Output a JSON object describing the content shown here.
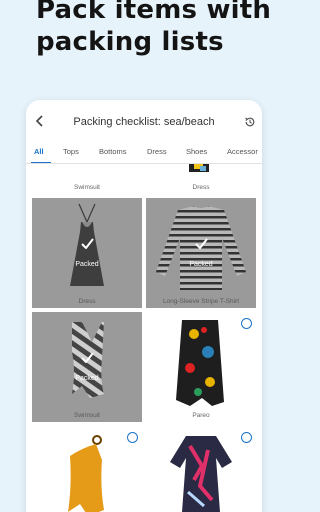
{
  "headline": {
    "line1": "Pack items with",
    "line2": "packing lists"
  },
  "appbar": {
    "title": "Packing checklist: sea/beach"
  },
  "tabs": [
    {
      "label": "All",
      "active": true
    },
    {
      "label": "Tops"
    },
    {
      "label": "Bottoms"
    },
    {
      "label": "Dress"
    },
    {
      "label": "Shoes"
    },
    {
      "label": "Accessor"
    }
  ],
  "partial_row": [
    "Swimsuit",
    "Dress"
  ],
  "items": [
    {
      "label": "Dress",
      "packed": true,
      "icon": "halter-dress"
    },
    {
      "label": "Long-Sleeve Stripe T-Shirt",
      "packed": true,
      "icon": "striped-longsleeve"
    },
    {
      "label": "Swimsuit",
      "packed": true,
      "icon": "striped-swimsuit"
    },
    {
      "label": "Pareo",
      "packed": false,
      "icon": "printed-pareo"
    },
    {
      "label": "",
      "packed": false,
      "icon": "yellow-swimsuit"
    },
    {
      "label": "",
      "packed": false,
      "icon": "printed-dress"
    }
  ],
  "packed_label": "Packed",
  "colors": {
    "accent": "#1a73c8",
    "background": "#e7f3fb",
    "packed_overlay": "#9a9a9a"
  }
}
